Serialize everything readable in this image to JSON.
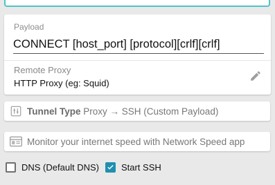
{
  "payload": {
    "label": "Payload",
    "value": "CONNECT [host_port] [protocol][crlf][crlf]"
  },
  "remote_proxy": {
    "label": "Remote Proxy",
    "value": "HTTP Proxy (eg: Squid)"
  },
  "tunnel": {
    "title": "Tunnel Type",
    "value": "Proxy → SSH (Custom Payload)"
  },
  "monitor": {
    "text": "Monitor your internet speed with Network Speed app"
  },
  "options": {
    "dns_label": "DNS (Default DNS)",
    "dns_checked": false,
    "ssh_label": "Start SSH",
    "ssh_checked": true
  },
  "colors": {
    "accent": "#4ec3c8",
    "checkbox_on": "#1f8fb0"
  },
  "icons": [
    "edit-pencil-icon",
    "tunnel-settings-icon",
    "speed-monitor-icon",
    "check-icon"
  ]
}
